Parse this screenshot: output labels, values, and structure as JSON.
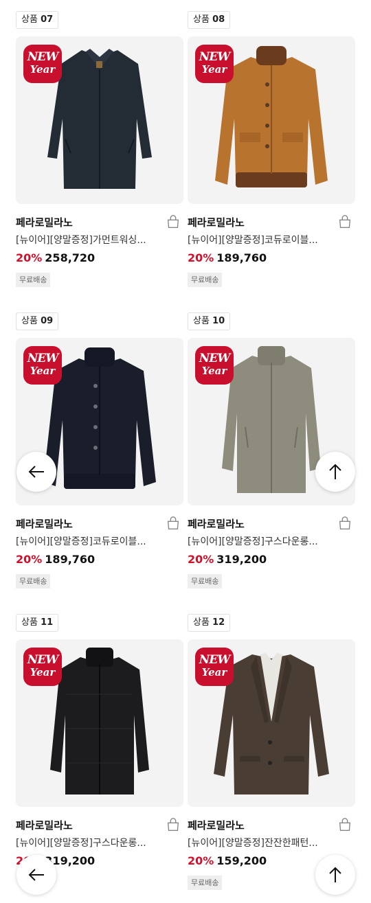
{
  "products": [
    {
      "tag_prefix": "상품",
      "tag_number": "07",
      "brand": "페라로밀라노",
      "name": "[뉴이어][양말증정]가먼트워싱...",
      "discount": "20%",
      "price": "258,720",
      "shipping": "무료배송",
      "badge_line1": "NEW",
      "badge_line2": "Year",
      "garment": "navy-single-coat",
      "color": "#232b35"
    },
    {
      "tag_prefix": "상품",
      "tag_number": "08",
      "brand": "페라로밀라노",
      "name": "[뉴이어][양말증정]코듀로이블...",
      "discount": "20%",
      "price": "189,760",
      "shipping": "무료배송",
      "badge_line1": "NEW",
      "badge_line2": "Year",
      "garment": "camel-corduroy-blouson",
      "color": "#b8732f"
    },
    {
      "tag_prefix": "상품",
      "tag_number": "09",
      "brand": "페라로밀라노",
      "name": "[뉴이어][양말증정]코듀로이블...",
      "discount": "20%",
      "price": "189,760",
      "shipping": "무료배송",
      "badge_line1": "NEW",
      "badge_line2": "Year",
      "garment": "navy-corduroy-blouson",
      "color": "#1a1e2b"
    },
    {
      "tag_prefix": "상품",
      "tag_number": "10",
      "brand": "페라로밀라노",
      "name": "[뉴이어][양말증정]구스다운롱...",
      "discount": "20%",
      "price": "319,200",
      "shipping": "무료배송",
      "badge_line1": "NEW",
      "badge_line2": "Year",
      "garment": "khaki-goose-down-long",
      "color": "#8e8c7c"
    },
    {
      "tag_prefix": "상품",
      "tag_number": "11",
      "brand": "페라로밀라노",
      "name": "[뉴이어][양말증정]구스다운롱...",
      "discount": "20%",
      "price": "319,200",
      "shipping": "",
      "badge_line1": "NEW",
      "badge_line2": "Year",
      "garment": "black-goose-down-long",
      "color": "#1c1c1e"
    },
    {
      "tag_prefix": "상품",
      "tag_number": "12",
      "brand": "페라로밀라노",
      "name": "[뉴이어][양말증정]잔잔한패턴...",
      "discount": "20%",
      "price": "159,200",
      "shipping": "무료배송",
      "badge_line1": "NEW",
      "badge_line2": "Year",
      "garment": "brown-tweed-blazer",
      "color": "#4a3d34"
    }
  ],
  "controls": {
    "back_icon": "arrow-left-icon",
    "top_icon": "arrow-up-icon",
    "cart_icon": "shopping-bag-icon"
  },
  "colors": {
    "discount": "#d0112b",
    "badge": "#c8102e",
    "image_bg": "#f3f3f3"
  }
}
